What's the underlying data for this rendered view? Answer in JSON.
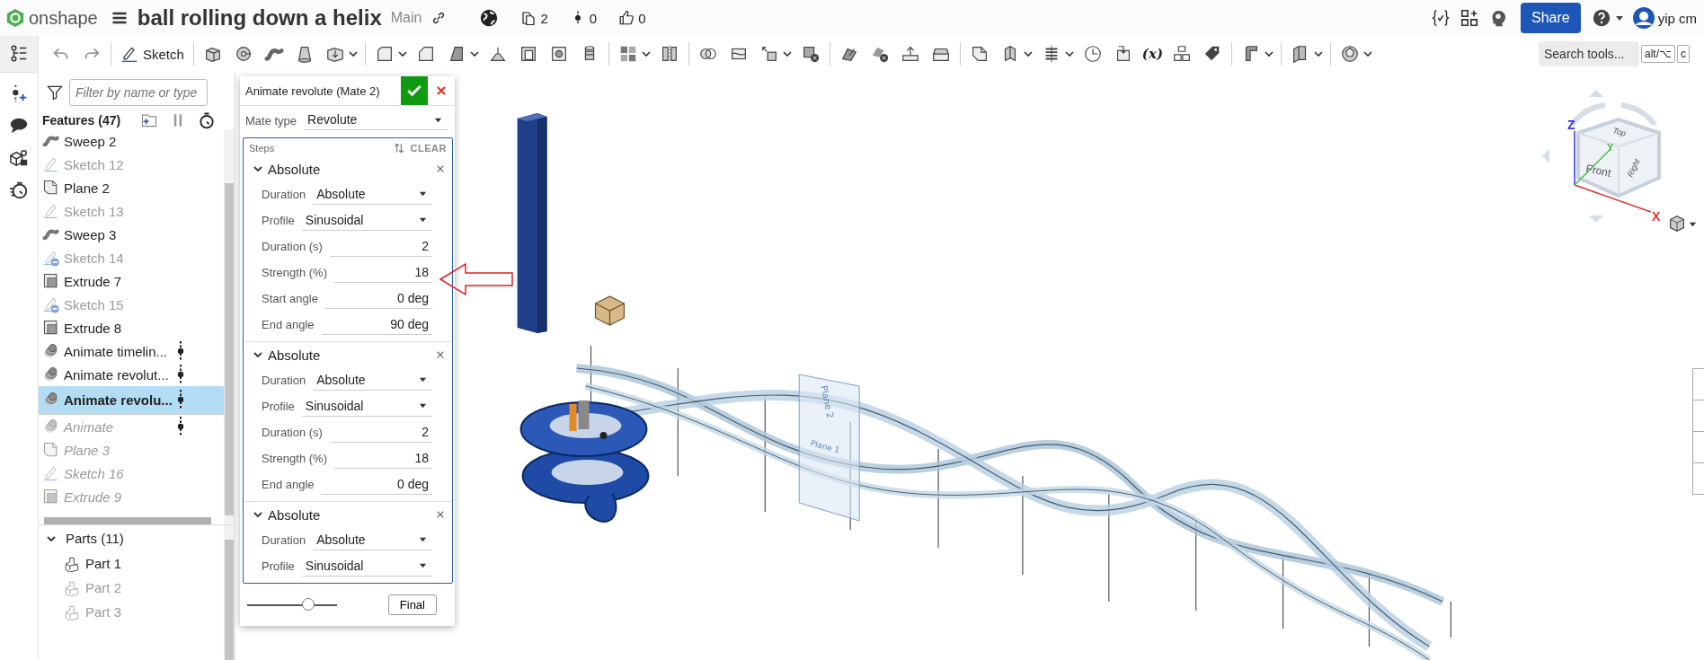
{
  "header": {
    "logo": "onshape",
    "title": "ball rolling down a helix",
    "branch": "Main",
    "counts": [
      {
        "kind": "versions",
        "value": "2"
      },
      {
        "kind": "graph",
        "value": "0"
      },
      {
        "kind": "likes",
        "value": "0"
      }
    ],
    "share": "Share",
    "user": "yip cm"
  },
  "toolbar": {
    "sketch": "Sketch",
    "variable": "(x)",
    "search": {
      "placeholder": "Search tools...",
      "keys": [
        "alt/⌥",
        "c"
      ]
    }
  },
  "feature_panel": {
    "filter": {
      "placeholder": "Filter by name or type"
    },
    "title": "Features (47)",
    "features": [
      {
        "name": "Sweep 2",
        "kind": "sweep",
        "hidden": false,
        "suppressed": false,
        "selected": false,
        "marked": false,
        "dependency": false
      },
      {
        "name": "Sketch 12",
        "kind": "sketch",
        "hidden": true,
        "suppressed": false,
        "selected": false,
        "marked": false,
        "dependency": false
      },
      {
        "name": "Plane 2",
        "kind": "plane",
        "hidden": false,
        "suppressed": false,
        "selected": false,
        "marked": false,
        "dependency": false
      },
      {
        "name": "Sketch 13",
        "kind": "sketch",
        "hidden": true,
        "suppressed": false,
        "selected": false,
        "marked": false,
        "dependency": false
      },
      {
        "name": "Sweep 3",
        "kind": "sweep",
        "hidden": false,
        "suppressed": false,
        "selected": false,
        "marked": false,
        "dependency": false
      },
      {
        "name": "Sketch 14",
        "kind": "sketch",
        "hidden": true,
        "suppressed": false,
        "selected": false,
        "marked": true,
        "dependency": false
      },
      {
        "name": "Extrude 7",
        "kind": "extrude",
        "hidden": false,
        "suppressed": false,
        "selected": false,
        "marked": false,
        "dependency": false
      },
      {
        "name": "Sketch 15",
        "kind": "sketch",
        "hidden": true,
        "suppressed": false,
        "selected": false,
        "marked": true,
        "dependency": false
      },
      {
        "name": "Extrude 8",
        "kind": "extrude",
        "hidden": false,
        "suppressed": false,
        "selected": false,
        "marked": false,
        "dependency": false
      },
      {
        "name": "Animate timelin...",
        "kind": "animate",
        "hidden": false,
        "suppressed": false,
        "selected": false,
        "marked": false,
        "dependency": true
      },
      {
        "name": "Animate revolut...",
        "kind": "animate",
        "hidden": false,
        "suppressed": false,
        "selected": false,
        "marked": false,
        "dependency": true
      },
      {
        "name": "Animate revolu...",
        "kind": "animate",
        "hidden": false,
        "suppressed": false,
        "selected": true,
        "marked": false,
        "dependency": true
      },
      {
        "name": "Animate",
        "kind": "animate",
        "hidden": false,
        "suppressed": true,
        "selected": false,
        "marked": false,
        "dependency": true
      },
      {
        "name": "Plane 3",
        "kind": "plane",
        "hidden": false,
        "suppressed": true,
        "selected": false,
        "marked": false,
        "dependency": false
      },
      {
        "name": "Sketch 16",
        "kind": "sketch",
        "hidden": false,
        "suppressed": true,
        "selected": false,
        "marked": false,
        "dependency": false
      },
      {
        "name": "Extrude 9",
        "kind": "extrude",
        "hidden": false,
        "suppressed": true,
        "selected": false,
        "marked": false,
        "dependency": false
      }
    ],
    "parts": {
      "title": "Parts (11)",
      "expanded": true,
      "items": [
        {
          "name": "Part 1",
          "hidden": false
        },
        {
          "name": "Part 2",
          "hidden": true
        },
        {
          "name": "Part 3",
          "hidden": true
        }
      ]
    }
  },
  "dialog": {
    "title": "Animate revolute (Mate 2)",
    "mate_type": {
      "label": "Mate type",
      "value": "Revolute"
    },
    "steps_label": "Steps",
    "clear": "CLEAR",
    "steps": [
      {
        "title": "Absolute",
        "expanded": true,
        "fields": [
          {
            "kind": "select",
            "label": "Duration",
            "value": "Absolute"
          },
          {
            "kind": "select",
            "label": "Profile",
            "value": "Sinusoidal"
          },
          {
            "kind": "number",
            "label": "Duration (s)",
            "value": "2"
          },
          {
            "kind": "number",
            "label": "Strength (%)",
            "value": "18"
          },
          {
            "kind": "number",
            "label": "Start angle",
            "value": "0 deg"
          },
          {
            "kind": "number",
            "label": "End angle",
            "value": "90 deg"
          }
        ]
      },
      {
        "title": "Absolute",
        "expanded": true,
        "fields": [
          {
            "kind": "select",
            "label": "Duration",
            "value": "Absolute"
          },
          {
            "kind": "select",
            "label": "Profile",
            "value": "Sinusoidal"
          },
          {
            "kind": "number",
            "label": "Duration (s)",
            "value": "2"
          },
          {
            "kind": "number",
            "label": "Strength (%)",
            "value": "18"
          },
          {
            "kind": "number",
            "label": "End angle",
            "value": "0 deg"
          }
        ]
      },
      {
        "title": "Absolute",
        "expanded": true,
        "fields": [
          {
            "kind": "select",
            "label": "Duration",
            "value": "Absolute"
          },
          {
            "kind": "select",
            "label": "Profile",
            "value": "Sinusoidal"
          }
        ]
      }
    ],
    "slider": {
      "level": 0.68
    },
    "final": "Final"
  },
  "viewport": {
    "plane_labels": [
      "Plane 2",
      "Plane 1"
    ],
    "view_cube": {
      "top": "Top",
      "front": "Front",
      "right": "Right",
      "x": "X",
      "y": "Y",
      "z": "Z"
    }
  }
}
